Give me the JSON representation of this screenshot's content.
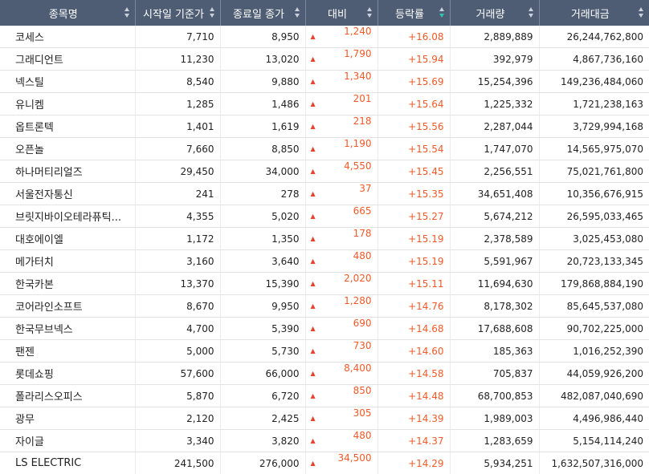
{
  "colors": {
    "header_bg": "#4e5d74",
    "rise": "#f05a28",
    "rise_arrow": "#e8432f",
    "sort_active": "#2ec4b6"
  },
  "icons": {
    "sort": "sort-arrows-icon",
    "rise": "triangle-up-icon"
  },
  "rise_glyph": "▲",
  "columns": [
    {
      "label": "종목명"
    },
    {
      "label": "시작일 기준가"
    },
    {
      "label": "종료일 종가"
    },
    {
      "label": "대비"
    },
    {
      "label": "등락률"
    },
    {
      "label": "거래량"
    },
    {
      "label": "거래대금"
    }
  ],
  "sorted_column": "등락률",
  "sort_direction": "descending",
  "rows": [
    {
      "name": "코세스",
      "start": "7,710",
      "end": "8,950",
      "diff": "1,240",
      "rate": "+16.08",
      "volume": "2,889,889",
      "amount": "26,244,762,800"
    },
    {
      "name": "그래디언트",
      "start": "11,230",
      "end": "13,020",
      "diff": "1,790",
      "rate": "+15.94",
      "volume": "392,979",
      "amount": "4,867,736,160"
    },
    {
      "name": "넥스틸",
      "start": "8,540",
      "end": "9,880",
      "diff": "1,340",
      "rate": "+15.69",
      "volume": "15,254,396",
      "amount": "149,236,484,060"
    },
    {
      "name": "유니켐",
      "start": "1,285",
      "end": "1,486",
      "diff": "201",
      "rate": "+15.64",
      "volume": "1,225,332",
      "amount": "1,721,238,163"
    },
    {
      "name": "옵트론텍",
      "start": "1,401",
      "end": "1,619",
      "diff": "218",
      "rate": "+15.56",
      "volume": "2,287,044",
      "amount": "3,729,994,168"
    },
    {
      "name": "오픈놀",
      "start": "7,660",
      "end": "8,850",
      "diff": "1,190",
      "rate": "+15.54",
      "volume": "1,747,070",
      "amount": "14,565,975,070"
    },
    {
      "name": "하나머티리얼즈",
      "start": "29,450",
      "end": "34,000",
      "diff": "4,550",
      "rate": "+15.45",
      "volume": "2,256,551",
      "amount": "75,021,761,800"
    },
    {
      "name": "서울전자통신",
      "start": "241",
      "end": "278",
      "diff": "37",
      "rate": "+15.35",
      "volume": "34,651,408",
      "amount": "10,356,676,915"
    },
    {
      "name": "브릿지바이오테라퓨틱...",
      "start": "4,355",
      "end": "5,020",
      "diff": "665",
      "rate": "+15.27",
      "volume": "5,674,212",
      "amount": "26,595,033,465"
    },
    {
      "name": "대호에이엘",
      "start": "1,172",
      "end": "1,350",
      "diff": "178",
      "rate": "+15.19",
      "volume": "2,378,589",
      "amount": "3,025,453,080"
    },
    {
      "name": "메가터치",
      "start": "3,160",
      "end": "3,640",
      "diff": "480",
      "rate": "+15.19",
      "volume": "5,591,967",
      "amount": "20,723,133,345"
    },
    {
      "name": "한국카본",
      "start": "13,370",
      "end": "15,390",
      "diff": "2,020",
      "rate": "+15.11",
      "volume": "11,694,630",
      "amount": "179,868,884,190"
    },
    {
      "name": "코어라인소프트",
      "start": "8,670",
      "end": "9,950",
      "diff": "1,280",
      "rate": "+14.76",
      "volume": "8,178,302",
      "amount": "85,645,537,080"
    },
    {
      "name": "한국무브넥스",
      "start": "4,700",
      "end": "5,390",
      "diff": "690",
      "rate": "+14.68",
      "volume": "17,688,608",
      "amount": "90,702,225,000"
    },
    {
      "name": "팬젠",
      "start": "5,000",
      "end": "5,730",
      "diff": "730",
      "rate": "+14.60",
      "volume": "185,363",
      "amount": "1,016,252,390"
    },
    {
      "name": "롯데쇼핑",
      "start": "57,600",
      "end": "66,000",
      "diff": "8,400",
      "rate": "+14.58",
      "volume": "705,837",
      "amount": "44,059,926,200"
    },
    {
      "name": "폴라리스오피스",
      "start": "5,870",
      "end": "6,720",
      "diff": "850",
      "rate": "+14.48",
      "volume": "68,700,853",
      "amount": "482,087,040,690"
    },
    {
      "name": "광무",
      "start": "2,120",
      "end": "2,425",
      "diff": "305",
      "rate": "+14.39",
      "volume": "1,989,003",
      "amount": "4,496,986,440"
    },
    {
      "name": "자이글",
      "start": "3,340",
      "end": "3,820",
      "diff": "480",
      "rate": "+14.37",
      "volume": "1,283,659",
      "amount": "5,154,114,240"
    },
    {
      "name": "LS ELECTRIC",
      "start": "241,500",
      "end": "276,000",
      "diff": "34,500",
      "rate": "+14.29",
      "volume": "5,934,251",
      "amount": "1,632,507,316,000"
    }
  ]
}
